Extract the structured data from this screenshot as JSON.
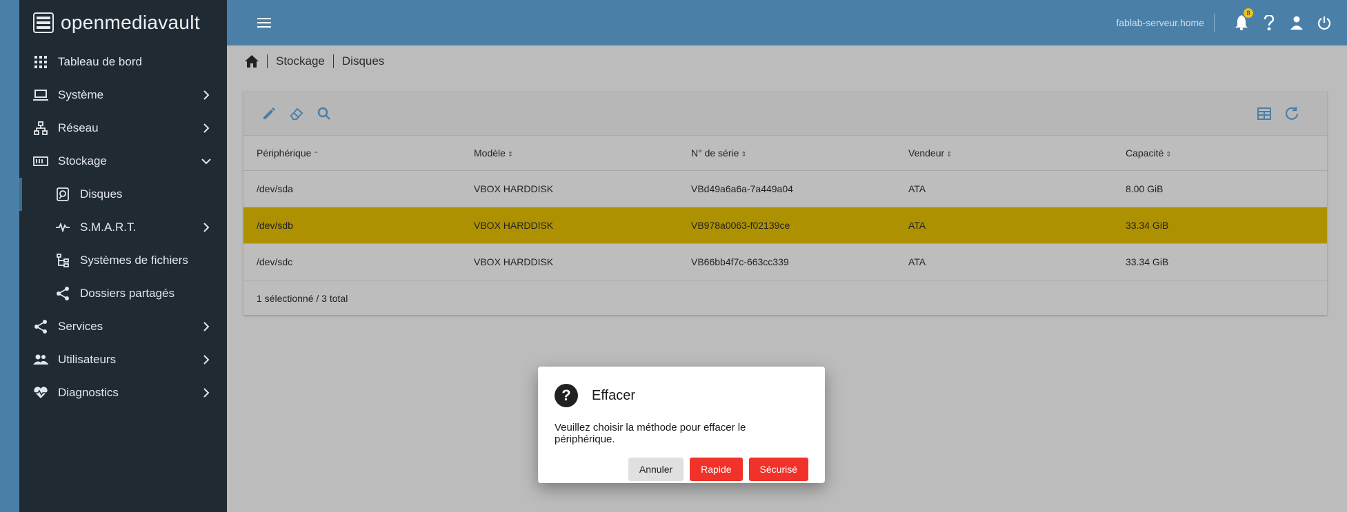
{
  "brand": {
    "name": "openmediavault"
  },
  "topbar": {
    "host": "fablab-serveur.home",
    "notifications": "8"
  },
  "sidebar": {
    "items": [
      {
        "label": "Tableau de bord",
        "icon": "grid-icon"
      },
      {
        "label": "Système",
        "icon": "laptop-icon"
      },
      {
        "label": "Réseau",
        "icon": "network-icon"
      },
      {
        "label": "Stockage",
        "icon": "storage-icon"
      },
      {
        "label": "Disques",
        "icon": "disk-icon"
      },
      {
        "label": "S.M.A.R.T.",
        "icon": "pulse-icon"
      },
      {
        "label": "Systèmes de fichiers",
        "icon": "file-tree-icon"
      },
      {
        "label": "Dossiers partagés",
        "icon": "share-icon"
      },
      {
        "label": "Services",
        "icon": "share-icon"
      },
      {
        "label": "Utilisateurs",
        "icon": "users-icon"
      },
      {
        "label": "Diagnostics",
        "icon": "heart-pulse-icon"
      }
    ]
  },
  "breadcrumb": {
    "items": [
      "Stockage",
      "Disques"
    ]
  },
  "table": {
    "headers": [
      "Périphérique",
      "Modèle",
      "N° de série",
      "Vendeur",
      "Capacité"
    ],
    "rows": [
      [
        "/dev/sda",
        "VBOX HARDDISK",
        "VBd49a6a6a-7a449a04",
        "ATA",
        "8.00 GiB"
      ],
      [
        "/dev/sdb",
        "VBOX HARDDISK",
        "VB978a0063-f02139ce",
        "ATA",
        "33.34 GiB"
      ],
      [
        "/dev/sdc",
        "VBOX HARDDISK",
        "VB66bb4f7c-663cc339",
        "ATA",
        "33.34 GiB"
      ]
    ],
    "footer": "1 sélectionné / 3 total"
  },
  "dialog": {
    "title": "Effacer",
    "message": "Veuillez choisir la méthode pour effacer le périphérique.",
    "cancel": "Annuler",
    "quick": "Rapide",
    "secure": "Sécurisé"
  },
  "colors": {
    "accent": "#4a7fa8",
    "sidebar": "#1f2a33",
    "selected_row": "#ae9100",
    "danger": "#f0322a"
  }
}
